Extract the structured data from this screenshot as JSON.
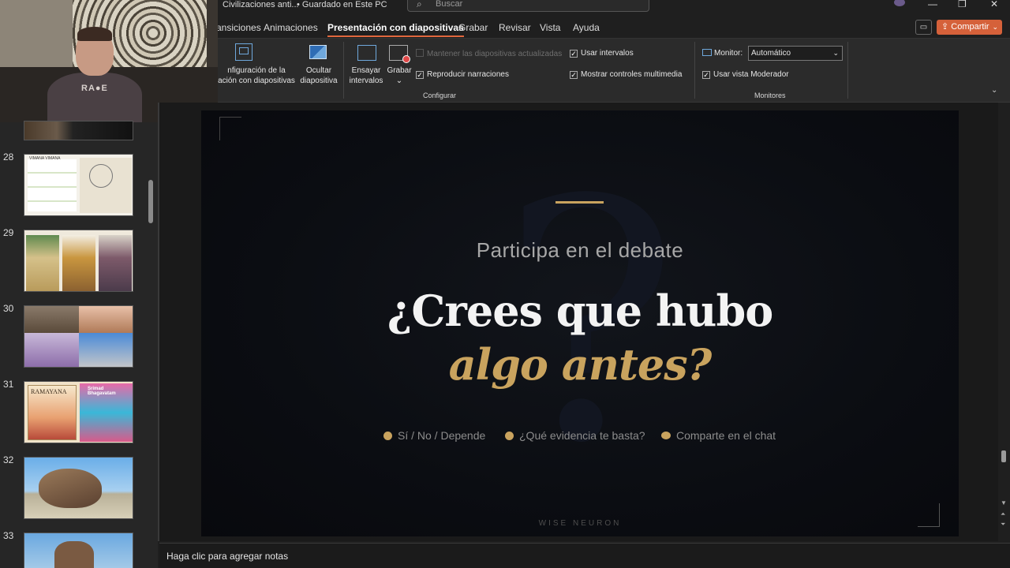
{
  "titlebar": {
    "document": "Civilizaciones anti...",
    "saved_status": "• Guardado en Este PC",
    "search_placeholder": "Buscar",
    "minimize_glyph": "—",
    "restore_glyph": "❐",
    "close_glyph": "✕"
  },
  "tabs": [
    {
      "label": "ansiciones"
    },
    {
      "label": "Animaciones"
    },
    {
      "label": "Presentación con diapositivas"
    },
    {
      "label": "Grabar"
    },
    {
      "label": "Revisar"
    },
    {
      "label": "Vista"
    },
    {
      "label": "Ayuda"
    }
  ],
  "share_label": "Compartir",
  "ribbon": {
    "config_line1": "nfiguración de la",
    "config_line2": "ación con diapositivas",
    "hide_line1": "Ocultar",
    "hide_line2": "diapositiva",
    "rehearse_line1": "Ensayar",
    "rehearse_line2": "intervalos",
    "record_label": "Grabar",
    "keep_updated": "Mantener las diapositivas actualizadas",
    "play_narrations": "Reproducir narraciones",
    "use_timings": "Usar intervalos",
    "show_media_controls": "Mostrar controles multimedia",
    "group_configure": "Configurar",
    "monitor_label": "Monitor:",
    "monitor_value": "Automático",
    "presenter_view": "Usar vista Moderador",
    "group_monitors": "Monitores"
  },
  "webcam": {
    "shirt_text": "RA●E"
  },
  "thumbnails": [
    {
      "number": "28"
    },
    {
      "number": "29"
    },
    {
      "number": "30"
    },
    {
      "number": "31"
    },
    {
      "number": "32"
    },
    {
      "number": "33"
    }
  ],
  "thumb_texts": {
    "vimana": "VIMANA VIMANA",
    "ramayana": "RAMAYANA",
    "bhagavatam": "Srimad Bhagavatam"
  },
  "slide": {
    "subtitle": "Participa en el debate",
    "headline": "¿Crees que hubo",
    "headline_accent": "algo antes?",
    "bullets": [
      "Sí / No / Depende",
      "¿Qué evidencia te basta?",
      "Comparte en el chat"
    ],
    "brand": "WISE NEURON"
  },
  "notes_placeholder": "Haga clic para agregar notas",
  "colors": {
    "accent_gold": "#c9a35e",
    "share_orange": "#d5613a",
    "slide_bg": "#0b0d12"
  }
}
